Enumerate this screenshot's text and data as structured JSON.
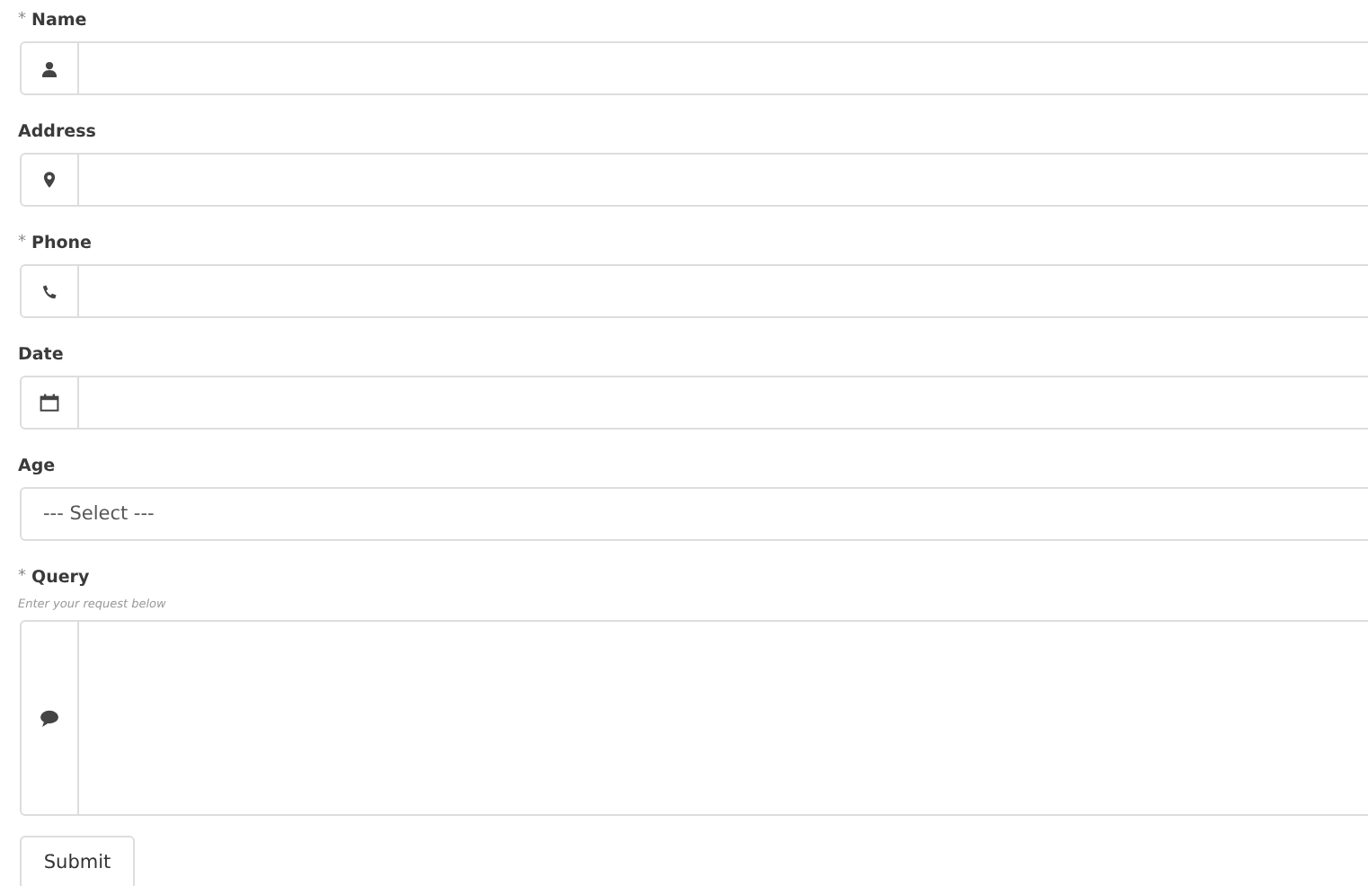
{
  "fields": [
    {
      "label": "Name",
      "required_mark": "*",
      "kind": "input"
    },
    {
      "label": "Address",
      "kind": "input"
    },
    {
      "label": "Phone",
      "required_mark": "*",
      "kind": "input"
    },
    {
      "label": "Date",
      "kind": "input"
    },
    {
      "label": "Age",
      "kind": "select",
      "value": "--- Select ---"
    },
    {
      "label": "Query",
      "required_mark": "*",
      "hint": "Enter your request below",
      "kind": "textarea"
    }
  ],
  "submit": "Submit"
}
